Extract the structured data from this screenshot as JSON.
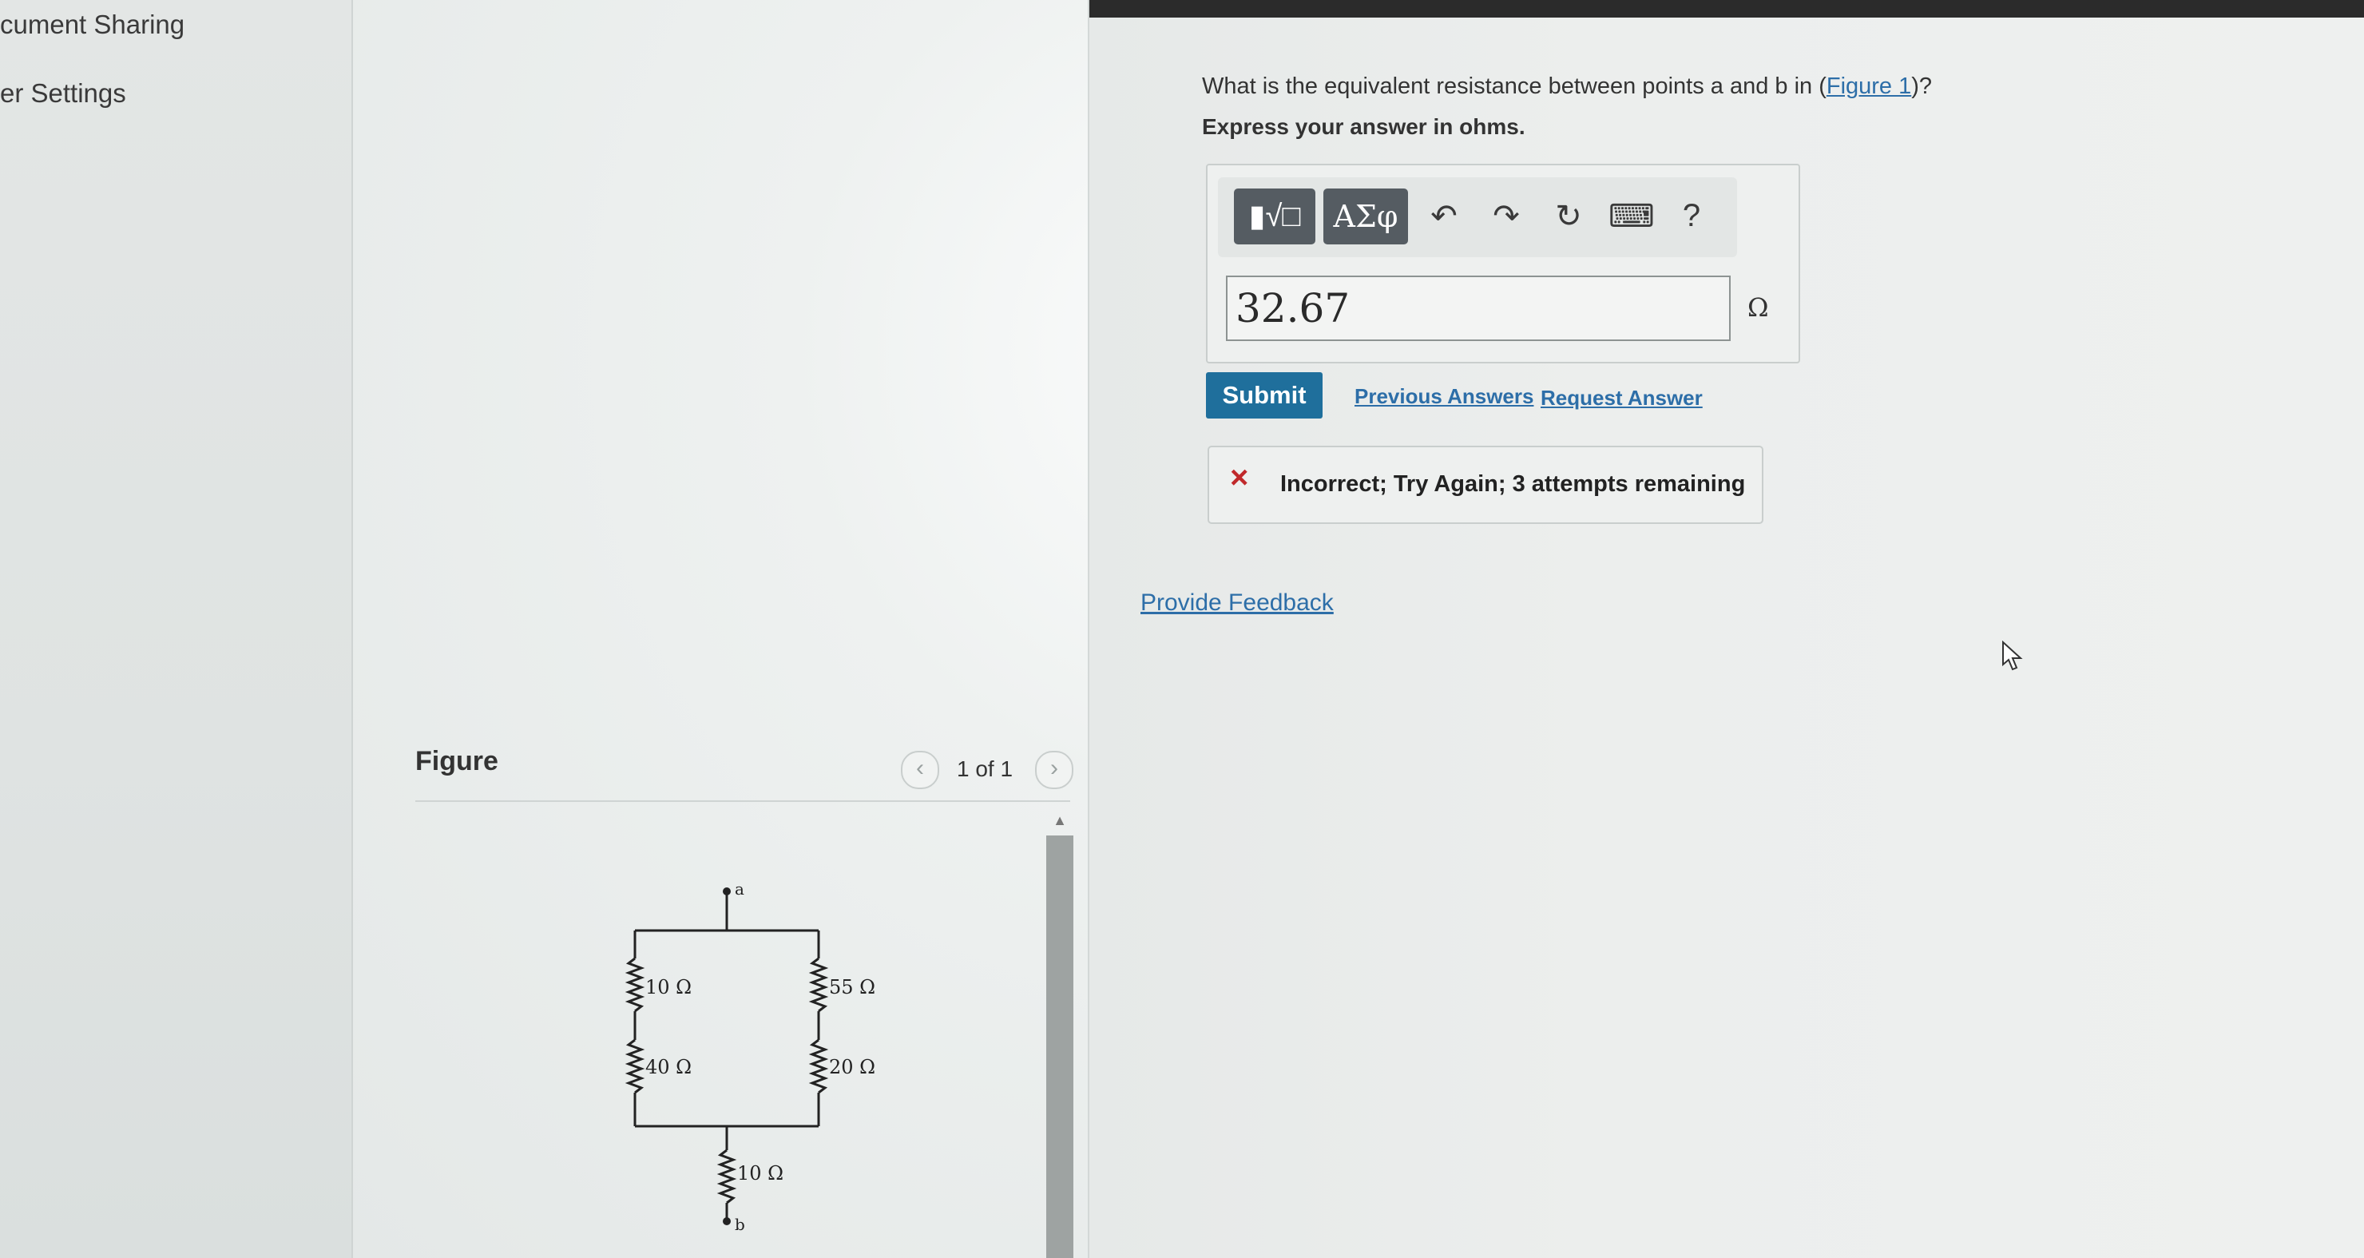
{
  "nav": {
    "items": [
      {
        "label": "cument Sharing"
      },
      {
        "label": "er Settings"
      }
    ]
  },
  "figure": {
    "title": "Figure",
    "pager": {
      "label": "1 of 1",
      "prev_icon": "chevron-left-icon",
      "next_icon": "chevron-right-icon"
    },
    "circuit": {
      "point_a": "a",
      "point_b": "b",
      "resistors": {
        "left_top": "10 Ω",
        "left_bottom": "40 Ω",
        "right_top": "55 Ω",
        "right_bottom": "20 Ω",
        "series": "10 Ω"
      }
    }
  },
  "question": {
    "text_prefix": "What is the equivalent resistance between points a and b in (",
    "figure_link": "Figure 1",
    "text_suffix": ")?",
    "instruction": "Express your answer in ohms."
  },
  "toolbar": {
    "templates_label": "▮√□",
    "symbols_label": "ΑΣφ",
    "undo_icon": "↶",
    "redo_icon": "↷",
    "reset_icon": "↻",
    "keyboard_icon": "⌨",
    "help_label": "?"
  },
  "answer": {
    "value": "32.67",
    "unit": "Ω"
  },
  "actions": {
    "submit_label": "Submit",
    "previous_answers_label": "Previous Answers",
    "request_answer_label": "Request Answer"
  },
  "feedback": {
    "status_icon": "×",
    "message": "Incorrect; Try Again; 3 attempts remaining",
    "status_color": "#c0292b"
  },
  "provide_feedback_label": "Provide Feedback",
  "colors": {
    "accent": "#1f6f9c",
    "link": "#2d6ea8"
  }
}
